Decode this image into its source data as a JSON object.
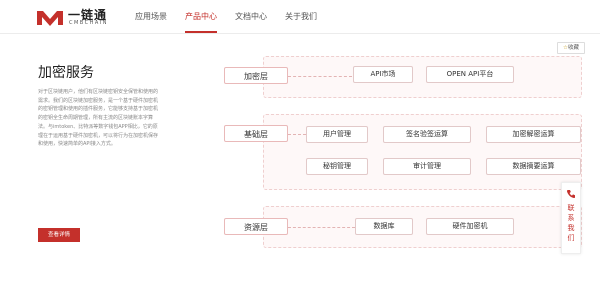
{
  "brand": {
    "name": "一链通",
    "subtitle": "CMBCHAIN",
    "logo_color": "#c4302b"
  },
  "nav": {
    "items": [
      {
        "label": "应用场景",
        "active": false
      },
      {
        "label": "产品中心",
        "active": true
      },
      {
        "label": "文档中心",
        "active": false
      },
      {
        "label": "关于我们",
        "active": false
      }
    ]
  },
  "main": {
    "title": "加密服务",
    "description": "对于区块链用户，他们有区块链密钥安全保管和使用的需求。我们的区块链加密服务，是一个基于硬件加密机的密钥管理和使用的插件服务，它能够支持基于加密机的密钥全生命周期管理，所有主流的区块链账本字算法。与imtoken、比特派等数字钱包APP相比，它的原理在于运用基于硬件加密机，可以将行为在加密机保存和使用，快速简单的API接入方式。",
    "cta_label": "查看详情"
  },
  "diagram": {
    "layers": [
      {
        "label": "加密层",
        "items": [
          "API市场",
          "OPEN API平台"
        ]
      },
      {
        "label": "基础层",
        "items": [
          "用户管理",
          "签名验签运算",
          "加密解密运算",
          "秘钥管理",
          "审计管理",
          "数据摘要运算"
        ]
      },
      {
        "label": "资源层",
        "items": [
          "数据库",
          "硬件加密机"
        ]
      }
    ]
  },
  "favorite": {
    "icon": "star-icon",
    "label": "收藏"
  },
  "contact": {
    "icon": "phone-icon",
    "label": "联系我们"
  },
  "colors": {
    "accent": "#c4302b",
    "panel_bg": "#fef8f8",
    "panel_border": "#efcfcf"
  }
}
